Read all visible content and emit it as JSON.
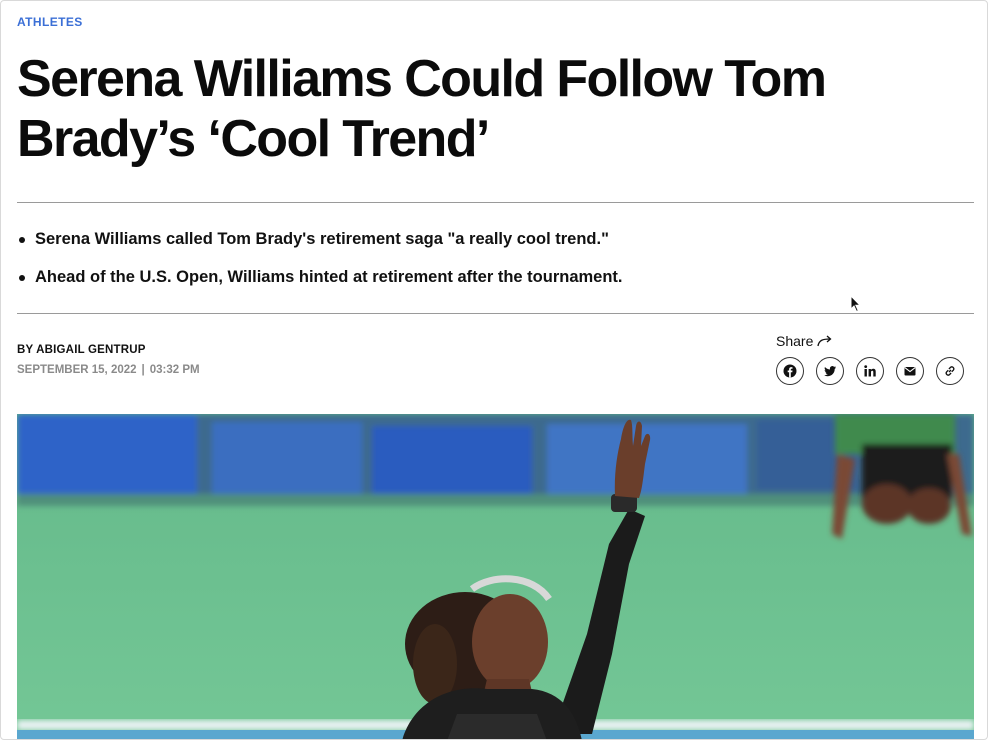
{
  "article": {
    "category": "ATHLETES",
    "headline": "Serena Williams Could Follow Tom Brady’s ‘Cool Trend’",
    "bullets": [
      "Serena Williams called Tom Brady's retirement saga \"a really cool trend.\"",
      "Ahead of the U.S. Open, Williams hinted at retirement after the tournament."
    ],
    "byline": "BY ABIGAIL GENTRUP",
    "date": "SEPTEMBER 15, 2022",
    "time": "03:32 PM"
  },
  "share": {
    "label": "Share",
    "icons": [
      "facebook-icon",
      "twitter-icon",
      "linkedin-icon",
      "email-icon",
      "link-icon"
    ]
  },
  "colors": {
    "category": "#3b6fd6",
    "date": "#8a8a8a",
    "court_green": "#6fc08f",
    "wall_blue": "#2f63c8"
  }
}
